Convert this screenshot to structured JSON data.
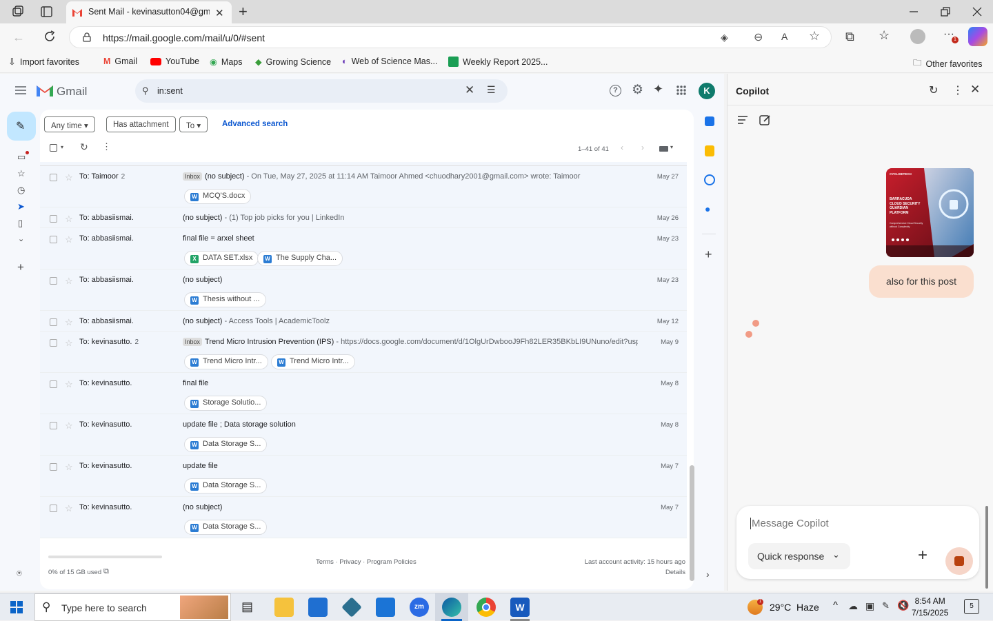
{
  "browser": {
    "tab_title": "Sent Mail - kevinasutton04@gma",
    "url": "https://mail.google.com/mail/u/0/#sent",
    "favorites": [
      "Import favorites",
      "Gmail",
      "YouTube",
      "Maps",
      "Growing Science",
      "Web of Science Mas...",
      "Weekly Report 2025..."
    ],
    "other_favorites": "Other favorites",
    "badge": "1"
  },
  "gmail": {
    "brand": "Gmail",
    "search_query": "in:sent",
    "avatar": "K",
    "filters": {
      "any_time": "Any time",
      "has_attachment": "Has attachment",
      "to": "To",
      "advanced": "Advanced search"
    },
    "pagination": "1–41 of 41",
    "rows": [
      {
        "to": "To: Taimoor",
        "count": "2",
        "label": "Inbox",
        "subject": "(no subject)",
        "snippet": " - On Tue, May 27, 2025 at 11:14 AM Taimoor Ahmed <chuodhary2001@gmail.com> wrote: Taimoor",
        "date": "May 27",
        "attachments": [
          {
            "name": "MCQ'S.docx",
            "type": "W"
          }
        ]
      },
      {
        "to": "To: abbasiismai.",
        "count": "",
        "label": "",
        "subject": "(no subject)",
        "snippet": " - (1) Top job picks for you | LinkedIn",
        "date": "May 26",
        "attachments": []
      },
      {
        "to": "To: abbasiismai.",
        "count": "",
        "label": "",
        "subject": "final file = arxel sheet",
        "snippet": "",
        "date": "May 23",
        "attachments": [
          {
            "name": "DATA SET.xlsx",
            "type": "X"
          },
          {
            "name": "The Supply Cha...",
            "type": "W"
          }
        ]
      },
      {
        "to": "To: abbasiismai.",
        "count": "",
        "label": "",
        "subject": "(no subject)",
        "snippet": "",
        "date": "May 23",
        "attachments": [
          {
            "name": "Thesis without ...",
            "type": "W"
          }
        ]
      },
      {
        "to": "To: abbasiismai.",
        "count": "",
        "label": "",
        "subject": "(no subject)",
        "snippet": " - Access Tools | AcademicToolz",
        "date": "May 12",
        "attachments": []
      },
      {
        "to": "To: kevinasutto.",
        "count": "2",
        "label": "Inbox",
        "subject": "Trend Micro Intrusion Prevention (IPS)",
        "snippet": " - https://docs.google.com/document/d/1OlgUrDwbooJ9Fh82LER35BKbLI9UNuno/edit?usp...",
        "date": "May 9",
        "attachments": [
          {
            "name": "Trend Micro Intr...",
            "type": "W"
          },
          {
            "name": "Trend Micro Intr...",
            "type": "W"
          }
        ]
      },
      {
        "to": "To: kevinasutto.",
        "count": "",
        "label": "",
        "subject": "final file",
        "snippet": "",
        "date": "May 8",
        "attachments": [
          {
            "name": "Storage Solutio...",
            "type": "W"
          }
        ]
      },
      {
        "to": "To: kevinasutto.",
        "count": "",
        "label": "",
        "subject": "update file ; Data storage solution",
        "snippet": "",
        "date": "May 8",
        "attachments": [
          {
            "name": "Data Storage S...",
            "type": "W"
          }
        ]
      },
      {
        "to": "To: kevinasutto.",
        "count": "",
        "label": "",
        "subject": "update file",
        "snippet": "",
        "date": "May 7",
        "attachments": [
          {
            "name": "Data Storage S...",
            "type": "W"
          }
        ]
      },
      {
        "to": "To: kevinasutto.",
        "count": "",
        "label": "",
        "subject": "(no subject)",
        "snippet": "",
        "date": "May 7",
        "attachments": [
          {
            "name": "Data Storage S...",
            "type": "W"
          }
        ]
      }
    ],
    "footer": {
      "storage": "0% of 15 GB used",
      "links": "Terms · Privacy · Program Policies",
      "activity": "Last account activity: 15 hours ago",
      "details": "Details"
    }
  },
  "copilot": {
    "title": "Copilot",
    "user_message": "also for this post",
    "placeholder": "Message Copilot",
    "quick_response": "Quick response",
    "post": {
      "brand": "CYCLIXETECH",
      "title": "BARRACUDA CLOUD SECURITY GUARDIAN PLATFORM",
      "sub": "Comprehensive Cloud Security without Complexity"
    }
  },
  "taskbar": {
    "search": "Type here to search",
    "weather": "29°C  Haze",
    "time": "8:54 AM",
    "date": "7/15/2025",
    "notifications": "5",
    "weather_badge": "1"
  }
}
